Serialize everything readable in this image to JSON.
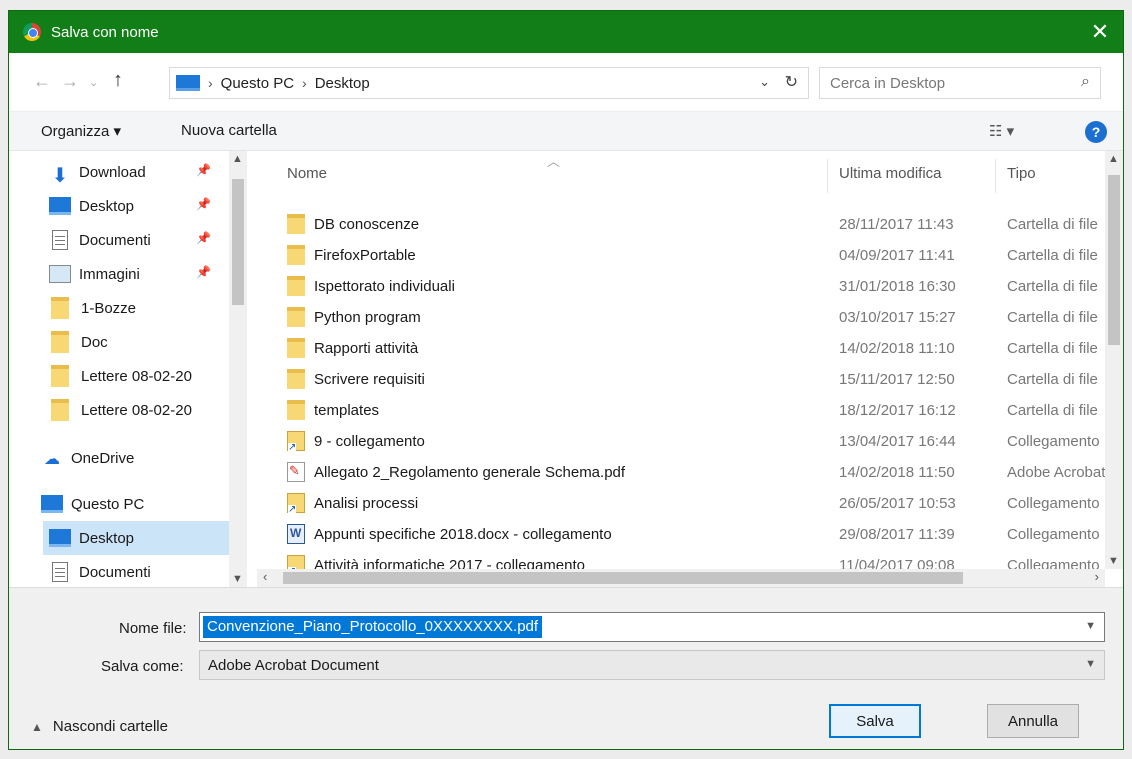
{
  "window": {
    "title": "Salva con nome",
    "close_glyph": "✕"
  },
  "address": {
    "crumbs": [
      "Questo PC",
      "Desktop"
    ],
    "separator": "›",
    "search_placeholder": "Cerca in Desktop"
  },
  "toolbar": {
    "organize_label": "Organizza ▾",
    "new_folder_label": "Nuova cartella",
    "view_label": "☷ ▾",
    "help_label": "?"
  },
  "nav": {
    "items": [
      {
        "label": "Download",
        "icon": "download-icon",
        "pinned": true
      },
      {
        "label": "Desktop",
        "icon": "desktop-icon",
        "pinned": true
      },
      {
        "label": "Documenti",
        "icon": "document-icon",
        "pinned": true
      },
      {
        "label": "Immagini",
        "icon": "image-icon",
        "pinned": true
      },
      {
        "label": "1-Bozze",
        "icon": "folder-icon"
      },
      {
        "label": "Doc",
        "icon": "folder-icon"
      },
      {
        "label": "Lettere 08-02-20",
        "icon": "folder-icon"
      },
      {
        "label": "Lettere 08-02-20",
        "icon": "folder-icon"
      },
      {
        "label": "OneDrive",
        "icon": "cloud-icon"
      },
      {
        "label": "Questo PC",
        "icon": "computer-icon"
      },
      {
        "label": "Desktop",
        "icon": "desktop-icon",
        "selected": true
      },
      {
        "label": "Documenti",
        "icon": "document-icon"
      }
    ]
  },
  "columns": {
    "name": "Nome",
    "modified": "Ultima modifica",
    "type": "Tipo"
  },
  "files": [
    {
      "name": "DB conoscenze",
      "date": "28/11/2017 11:43",
      "type": "Cartella di file",
      "kind": "folder"
    },
    {
      "name": "FirefoxPortable",
      "date": "04/09/2017 11:41",
      "type": "Cartella di file",
      "kind": "folder"
    },
    {
      "name": "Ispettorato individuali",
      "date": "31/01/2018 16:30",
      "type": "Cartella di file",
      "kind": "folder"
    },
    {
      "name": "Python program",
      "date": "03/10/2017 15:27",
      "type": "Cartella di file",
      "kind": "folder"
    },
    {
      "name": "Rapporti attività",
      "date": "14/02/2018 11:10",
      "type": "Cartella di file",
      "kind": "folder"
    },
    {
      "name": "Scrivere requisiti",
      "date": "15/11/2017 12:50",
      "type": "Cartella di file",
      "kind": "folder"
    },
    {
      "name": "templates",
      "date": "18/12/2017 16:12",
      "type": "Cartella di file",
      "kind": "folder"
    },
    {
      "name": "9 - collegamento",
      "date": "13/04/2017 16:44",
      "type": "Collegamento",
      "kind": "link"
    },
    {
      "name": "Allegato 2_Regolamento generale Schema.pdf",
      "date": "14/02/2018 11:50",
      "type": "Adobe Acrobat",
      "kind": "pdf"
    },
    {
      "name": "Analisi processi",
      "date": "26/05/2017 10:53",
      "type": "Collegamento",
      "kind": "link"
    },
    {
      "name": "Appunti specifiche 2018.docx - collegamento",
      "date": "29/08/2017 11:39",
      "type": "Collegamento",
      "kind": "word"
    },
    {
      "name": "Attività informatiche 2017 - collegamento",
      "date": "11/04/2017 09:08",
      "type": "Collegamento",
      "kind": "link"
    }
  ],
  "form": {
    "filename_label": "Nome file:",
    "filename_value": "Convenzione_Piano_Protocollo_0XXXXXXXX.pdf",
    "savetype_label": "Salva come:",
    "savetype_value": "Adobe Acrobat Document",
    "hide_folders_label": "Nascondi cartelle",
    "save_label": "Salva",
    "cancel_label": "Annulla"
  }
}
